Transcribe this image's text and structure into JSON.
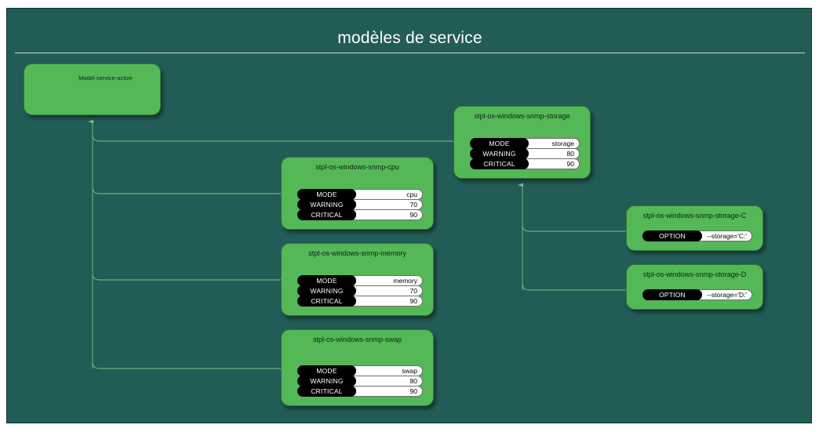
{
  "panel": {
    "title": "modèles de service",
    "background_color": "#225c56",
    "node_color": "#54b857",
    "edge_color": "#7fbf7f"
  },
  "keys": {
    "mode": "MODE",
    "warning": "WARNING",
    "critical": "CRITICAL",
    "option": "OPTION"
  },
  "nodes": {
    "root": {
      "title": "Model-service-active"
    },
    "cpu": {
      "title": "stpl-os-windows-snmp-cpu",
      "rows": [
        {
          "key": "MODE",
          "value": "cpu"
        },
        {
          "key": "WARNING",
          "value": "70"
        },
        {
          "key": "CRITICAL",
          "value": "90"
        }
      ]
    },
    "memory": {
      "title": "stpl-os-windows-snmp-memory",
      "rows": [
        {
          "key": "MODE",
          "value": "memory"
        },
        {
          "key": "WARNING",
          "value": "70"
        },
        {
          "key": "CRITICAL",
          "value": "90"
        }
      ]
    },
    "swap": {
      "title": "stpl-os-windows-snmp-swap",
      "rows": [
        {
          "key": "MODE",
          "value": "swap"
        },
        {
          "key": "WARNING",
          "value": "80"
        },
        {
          "key": "CRITICAL",
          "value": "90"
        }
      ]
    },
    "storage": {
      "title": "stpl-os-windows-snmp-storage",
      "rows": [
        {
          "key": "MODE",
          "value": "storage"
        },
        {
          "key": "WARNING",
          "value": "80"
        },
        {
          "key": "CRITICAL",
          "value": "90"
        }
      ]
    },
    "storage_c": {
      "title": "stpl-os-windows-snmp-storage-C",
      "rows": [
        {
          "key": "OPTION",
          "value": "--storage='C:'"
        }
      ]
    },
    "storage_d": {
      "title": "stpl-os-windows-snmp-storage-D",
      "rows": [
        {
          "key": "OPTION",
          "value": "--storage='D:'"
        }
      ]
    }
  }
}
